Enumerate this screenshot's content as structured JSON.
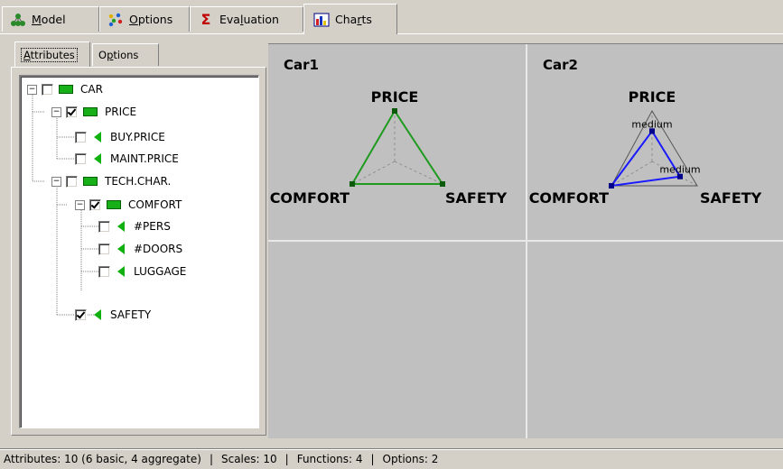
{
  "tabs": [
    {
      "label": "Model",
      "key": "M",
      "icon": "model-icon"
    },
    {
      "label": "Options",
      "key": "O",
      "icon": "options-icon"
    },
    {
      "label": "Evaluation",
      "key": "l",
      "icon": "sigma-icon"
    },
    {
      "label": "Charts",
      "key": "r",
      "icon": "charts-icon"
    }
  ],
  "active_tab": "Charts",
  "left_tabs": [
    {
      "label": "Attributes"
    },
    {
      "label": "Options"
    }
  ],
  "tree": [
    {
      "label": "CAR",
      "checked": false,
      "kind": "aggregate",
      "expander": "−"
    },
    {
      "label": "PRICE",
      "checked": true,
      "kind": "aggregate",
      "expander": "−"
    },
    {
      "label": "BUY.PRICE",
      "checked": false,
      "kind": "basic"
    },
    {
      "label": "MAINT.PRICE",
      "checked": false,
      "kind": "basic"
    },
    {
      "label": "TECH.CHAR.",
      "checked": false,
      "kind": "aggregate",
      "expander": "−"
    },
    {
      "label": "COMFORT",
      "checked": true,
      "kind": "aggregate",
      "expander": "−"
    },
    {
      "label": "#PERS",
      "checked": false,
      "kind": "basic"
    },
    {
      "label": "#DOORS",
      "checked": false,
      "kind": "basic"
    },
    {
      "label": "LUGGAGE",
      "checked": false,
      "kind": "basic"
    },
    {
      "label": "SAFETY",
      "checked": true,
      "kind": "basic"
    }
  ],
  "charts": [
    {
      "title": "Car1",
      "axes": [
        "PRICE",
        "SAFETY",
        "COMFORT"
      ],
      "values": [
        1,
        1,
        1
      ],
      "value_labels": [
        "",
        "",
        ""
      ],
      "color": "#1e9a1e"
    },
    {
      "title": "Car2",
      "axes": [
        "PRICE",
        "SAFETY",
        "COMFORT"
      ],
      "values": [
        0.6,
        0.62,
        1
      ],
      "value_labels": [
        "medium",
        "medium",
        ""
      ],
      "color": "#1a1aff"
    }
  ],
  "status": {
    "attributes": "Attributes: 10 (6 basic, 4 aggregate)",
    "scales": "Scales: 10",
    "functions": "Functions: 4",
    "options": "Options: 2"
  }
}
